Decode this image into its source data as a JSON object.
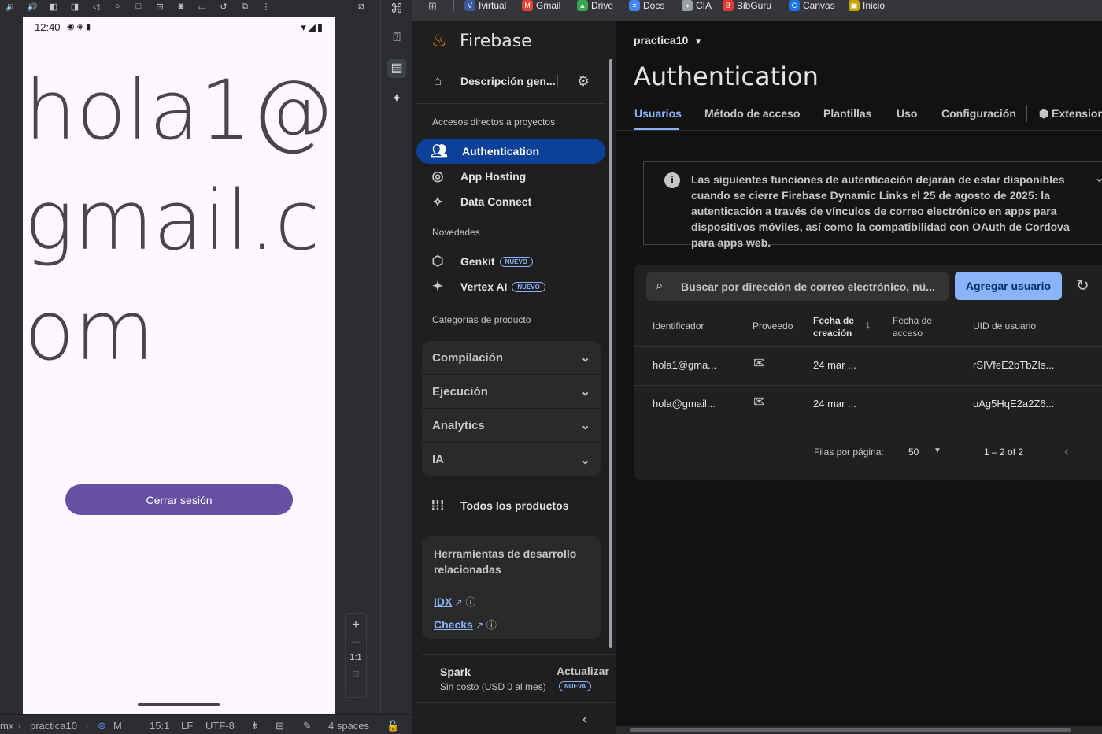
{
  "ide": {
    "toolbar_icons": [
      "volume-down-icon",
      "volume-up-icon",
      "fold-icon",
      "unfold-icon",
      "back-icon",
      "home-icon",
      "overview-icon",
      "screen-record-icon",
      "screenshot-icon",
      "video-icon",
      "rotate-icon",
      "extend-icon",
      "more-icon",
      "pin-icon"
    ],
    "device": {
      "time": "12:40",
      "email_text": "hola1@gmail.com",
      "logout_label": "Cerrar sesión"
    },
    "zoom": {
      "plus": "+",
      "minus": "—",
      "ratio": "1:1"
    },
    "statusbar": {
      "crumb_start": "mx",
      "crumb_project": "practica10",
      "crumb_file": "M",
      "position": "15:1",
      "line_ending": "LF",
      "encoding": "UTF-8",
      "indent": "4 spaces"
    }
  },
  "bookmarks": [
    {
      "label": "Ivirtual",
      "color": "#3b5998",
      "glyph": "V"
    },
    {
      "label": "Gmail",
      "color": "#ea4335",
      "glyph": "M"
    },
    {
      "label": "Drive",
      "color": "#34a853",
      "glyph": "▲"
    },
    {
      "label": "Docs",
      "color": "#4285f4",
      "glyph": "≡"
    },
    {
      "label": "CIA",
      "color": "#9aa0a6",
      "glyph": "◑"
    },
    {
      "label": "BibGuru",
      "color": "#e53935",
      "glyph": "B"
    },
    {
      "label": "Canvas",
      "color": "#1a73e8",
      "glyph": "C"
    },
    {
      "label": "Inicio",
      "color": "#c5a300",
      "glyph": "▣"
    }
  ],
  "sidebar": {
    "brand": "Firebase",
    "overview": "Descripción gen...",
    "shortcuts_title": "Accesos directos a proyectos",
    "shortcuts": [
      {
        "label": "Authentication",
        "icon": "users-icon",
        "active": true
      },
      {
        "label": "App Hosting",
        "icon": "hosting-icon",
        "active": false
      },
      {
        "label": "Data Connect",
        "icon": "data-connect-icon",
        "active": false
      }
    ],
    "news_title": "Novedades",
    "news": [
      {
        "label": "Genkit",
        "badge": "NUEVO"
      },
      {
        "label": "Vertex AI",
        "badge": "NUEVO"
      }
    ],
    "categories_title": "Categorías de producto",
    "categories": [
      "Compilación",
      "Ejecución",
      "Analytics",
      "IA"
    ],
    "all_products": "Todos los productos",
    "tools_title": "Herramientas de desarrollo relacionadas",
    "tools": [
      "IDX",
      "Checks"
    ],
    "plan_name": "Spark",
    "plan_desc": "Sin costo (USD 0 al mes)",
    "upgrade": "Actualizar",
    "upgrade_badge": "NUEVA"
  },
  "main": {
    "project": "practica10",
    "title": "Authentication",
    "tabs": [
      "Usuarios",
      "Método de acceso",
      "Plantillas",
      "Uso",
      "Configuración",
      "Extension"
    ],
    "notice": "Las siguientes funciones de autenticación dejarán de estar disponibles cuando se cierre Firebase Dynamic Links el 25 de agosto de 2025: la autenticación a través de vínculos de correo electrónico en apps para dispositivos móviles, así como la compatibilidad con OAuth de Cordova para apps web.",
    "search_placeholder": "Buscar por dirección de correo electrónico, nú...",
    "add_user": "Agregar usuario",
    "columns": [
      "Identificador",
      "Proveedo",
      "Fecha de creación",
      "Fecha de acceso",
      "UID de usuario"
    ],
    "rows": [
      {
        "id": "hola1@gma...",
        "created": "24 mar ...",
        "accessed": "",
        "uid": "rSIVfeE2bTbZIs..."
      },
      {
        "id": "hola@gmail...",
        "created": "24 mar ...",
        "accessed": "",
        "uid": "uAg5HqE2a2Z6..."
      }
    ],
    "rows_per_page_label": "Filas por página:",
    "rows_per_page": "50",
    "range": "1 – 2 of 2"
  },
  "colors": {
    "active_nav": "#0b4198",
    "primary_button": "#8ab4f8",
    "logout_button": "#6750a4"
  }
}
